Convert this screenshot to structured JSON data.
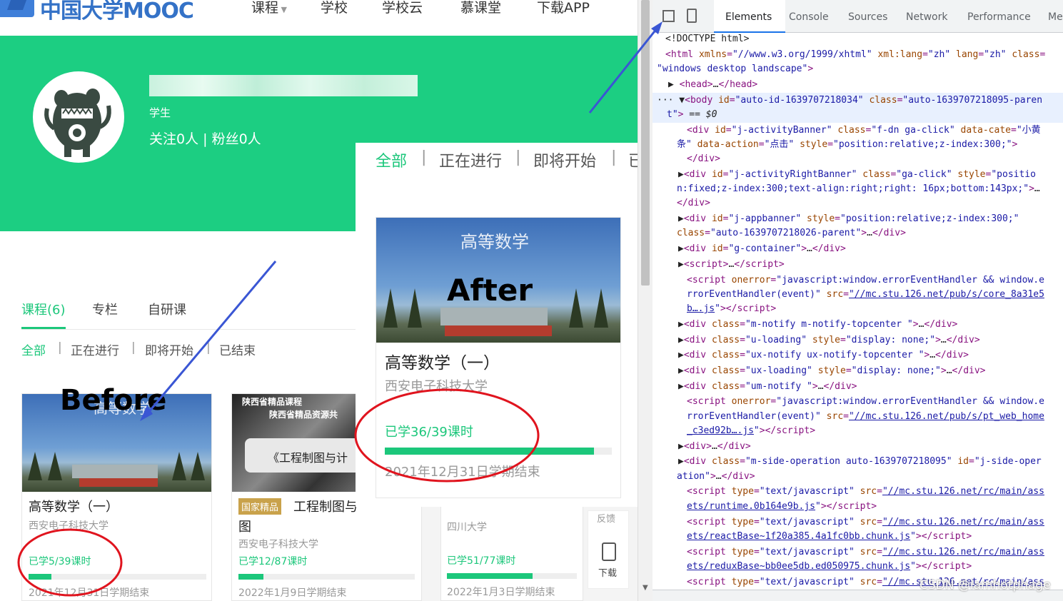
{
  "header": {
    "logo": "中国大学MOOC",
    "nav": [
      "课程",
      "学校",
      "学校云",
      "慕课堂",
      "下载APP"
    ]
  },
  "profile": {
    "role": "学生",
    "follow": "关注0人 | 粉丝0人"
  },
  "filters_large": [
    "全部",
    "正在进行",
    "即将开始",
    "已"
  ],
  "tabs": [
    "课程(6)",
    "专栏",
    "自研课"
  ],
  "filters": [
    "全部",
    "正在进行",
    "即将开始",
    "已结束"
  ],
  "annotations": {
    "before": "Before",
    "after": "After"
  },
  "cards": [
    {
      "title": "高等数学（一）",
      "school": "西安电子科技大学",
      "progress_text": "已学5/39课时",
      "progress": 0.13,
      "end": "2021年12月31日学期结束",
      "img_title": "高等数学"
    },
    {
      "badge": "国家精品",
      "title": "工程制图与",
      "title2": "图",
      "school": "西安电子科技大学",
      "progress_text": "已学12/87课时",
      "progress": 0.14,
      "end": "2022年1月9日学期结束",
      "img_title1": "陕西省精品课程",
      "img_title2": "陕西省精品资源共",
      "img_title3": "《工程制图与计"
    },
    {
      "school": "四川大学",
      "progress_text": "已学51/77课时",
      "progress": 0.66,
      "end": "2022年1月3日学期结束"
    }
  ],
  "big_card": {
    "img_title": "高等数学",
    "title": "高等数学（一）",
    "school": "西安电子科技大学",
    "progress_text": "已学36/39课时",
    "progress": 0.92,
    "end": "2021年12月31日学期结束"
  },
  "side": {
    "download": "下载",
    "upper": "反馈"
  },
  "devtools": {
    "tabs": [
      "Elements",
      "Console",
      "Sources",
      "Network",
      "Performance",
      "Me"
    ],
    "watermark": "CSDN @iamhotphage"
  }
}
